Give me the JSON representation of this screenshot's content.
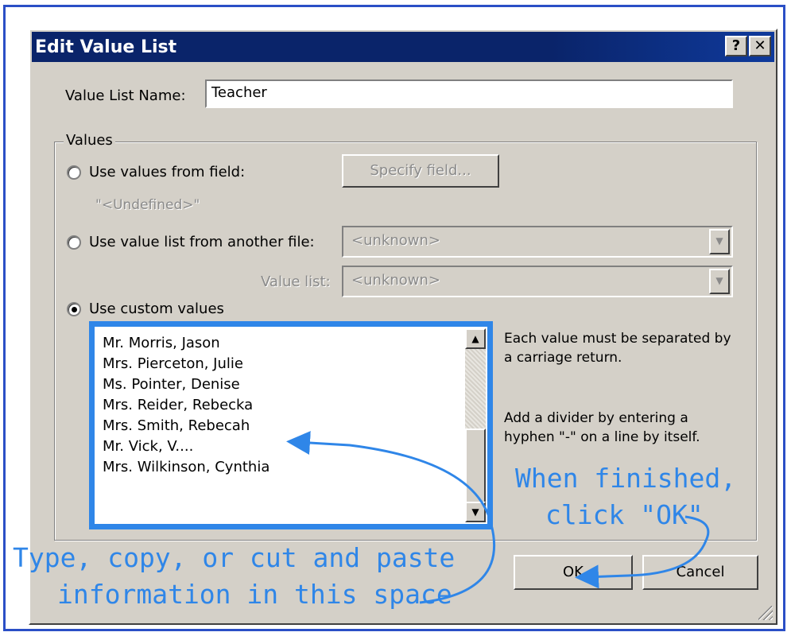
{
  "dialog": {
    "title": "Edit Value List",
    "help_button": "?",
    "close_button": "✕"
  },
  "name_field": {
    "label": "Value List Name:",
    "value": "Teacher"
  },
  "values_group": {
    "title": "Values",
    "option_field": {
      "label": "Use values from field:",
      "button": "Specify field...",
      "undefined_text": "\"<Undefined>\""
    },
    "option_file": {
      "label": "Use value list from another file:",
      "file_value": "<unknown>",
      "value_list_label": "Value list:",
      "value_list_value": "<unknown>"
    },
    "option_custom": {
      "label": "Use custom values",
      "selected": true
    },
    "custom_values": [
      "Mr. Morris, Jason",
      "Mrs. Pierceton, Julie",
      "Ms. Pointer, Denise",
      "Mrs. Reider, Rebecka",
      "Mrs. Smith, Rebecah",
      "Mr. Vick, V....",
      "Mrs. Wilkinson, Cynthia"
    ],
    "help1": "Each value must be separated by a carriage return.",
    "help2": "Add a divider by entering a hyphen \"-\" on a line by itself."
  },
  "buttons": {
    "ok": "OK",
    "cancel": "Cancel"
  },
  "annotations": {
    "finished_line1": "When finished,",
    "finished_line2": "click \"OK\"",
    "type_line1": "Type, copy, or cut and paste",
    "type_line2": "information in this space"
  },
  "colors": {
    "title_bar": "#0a246a",
    "annotation_blue": "#2f86e8",
    "frame_blue": "#2b4fc6",
    "dialog_face": "#d4d0c8"
  }
}
